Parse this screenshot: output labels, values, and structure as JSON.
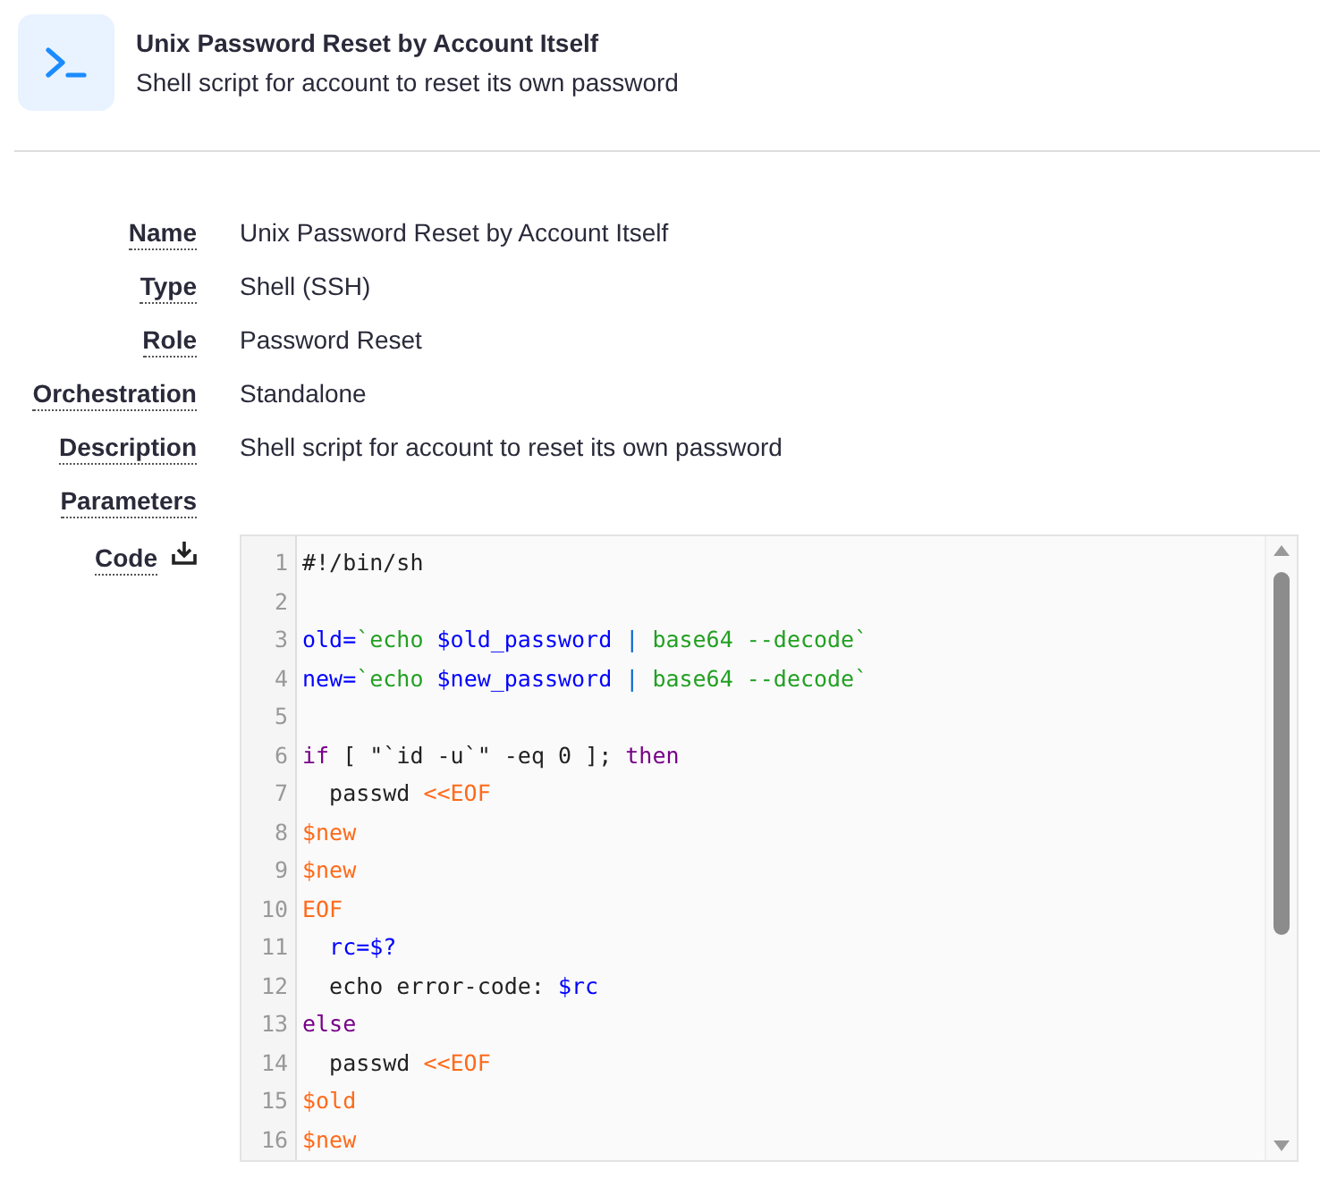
{
  "header": {
    "title": "Unix Password Reset by Account Itself",
    "subtitle": "Shell script for account to reset its own password"
  },
  "fields": [
    {
      "label": "Name",
      "value": "Unix Password Reset by Account Itself"
    },
    {
      "label": "Type",
      "value": "Shell (SSH)"
    },
    {
      "label": "Role",
      "value": "Password Reset"
    },
    {
      "label": "Orchestration",
      "value": "Standalone"
    },
    {
      "label": "Description",
      "value": "Shell script for account to reset its own password"
    },
    {
      "label": "Parameters"
    }
  ],
  "code": {
    "label": "Code",
    "lines": [
      {
        "number": "1",
        "tokens": [
          {
            "kind": "plain",
            "text": "#!/bin/sh"
          }
        ]
      },
      {
        "number": "2"
      },
      {
        "number": "3",
        "tokens": [
          {
            "kind": "def",
            "text": "old="
          },
          {
            "kind": "string",
            "text": "`echo "
          },
          {
            "kind": "def",
            "text": "$old_password"
          },
          {
            "kind": "operator",
            "text": " | "
          },
          {
            "kind": "string",
            "text": "base64 --decode`"
          }
        ]
      },
      {
        "number": "4",
        "tokens": [
          {
            "kind": "def",
            "text": "new="
          },
          {
            "kind": "string",
            "text": "`echo "
          },
          {
            "kind": "def",
            "text": "$new_password"
          },
          {
            "kind": "operator",
            "text": " | "
          },
          {
            "kind": "string",
            "text": "base64 --decode`"
          }
        ]
      },
      {
        "number": "5"
      },
      {
        "number": "6",
        "tokens": [
          {
            "kind": "keyword",
            "text": "if"
          },
          {
            "kind": "plain",
            "text": " [ \"`id -u`\" -eq 0 ]; "
          },
          {
            "kind": "keyword",
            "text": "then"
          }
        ]
      },
      {
        "number": "7",
        "tokens": [
          {
            "kind": "plain",
            "text": "  passwd "
          },
          {
            "kind": "heredoc",
            "text": "<<EOF"
          }
        ]
      },
      {
        "number": "8",
        "tokens": [
          {
            "kind": "heredoc",
            "text": "$new"
          }
        ]
      },
      {
        "number": "9",
        "tokens": [
          {
            "kind": "heredoc",
            "text": "$new"
          }
        ]
      },
      {
        "number": "10",
        "tokens": [
          {
            "kind": "heredoc",
            "text": "EOF"
          }
        ]
      },
      {
        "number": "11",
        "tokens": [
          {
            "kind": "def",
            "text": "  rc=$?"
          }
        ]
      },
      {
        "number": "12",
        "tokens": [
          {
            "kind": "plain",
            "text": "  echo error-code: "
          },
          {
            "kind": "def",
            "text": "$rc"
          }
        ]
      },
      {
        "number": "13",
        "tokens": [
          {
            "kind": "keyword",
            "text": "else"
          }
        ]
      },
      {
        "number": "14",
        "tokens": [
          {
            "kind": "plain",
            "text": "  passwd "
          },
          {
            "kind": "heredoc",
            "text": "<<EOF"
          }
        ]
      },
      {
        "number": "15",
        "tokens": [
          {
            "kind": "heredoc",
            "text": "$old"
          }
        ]
      },
      {
        "number": "16",
        "tokens": [
          {
            "kind": "heredoc",
            "text": "$new"
          }
        ]
      }
    ]
  }
}
